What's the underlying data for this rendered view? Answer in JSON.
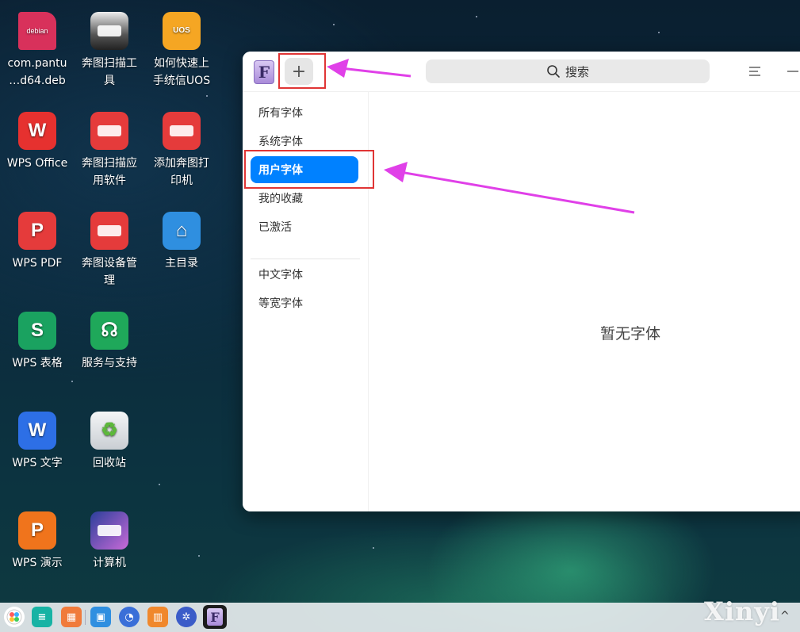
{
  "desktop": {
    "icons": [
      {
        "label": "com.pantu\n…d64.deb",
        "icon": "debian-package-icon",
        "glyph": "debian",
        "color": "#d8315b"
      },
      {
        "label": "奔图扫描工\n具",
        "icon": "scanner-icon",
        "glyph": "",
        "color": "#5a6470"
      },
      {
        "label": "如何快速上\n手统信UOS",
        "icon": "lightbulb-icon",
        "glyph": "UOS",
        "color": "#f5a623"
      },
      {
        "label": "WPS Office",
        "icon": "wps-office-icon",
        "glyph": "W",
        "color": "#e6312f"
      },
      {
        "label": "奔图扫描应\n用软件",
        "icon": "scanner-app-icon",
        "glyph": "",
        "color": "#e53b3b"
      },
      {
        "label": "添加奔图打\n印机",
        "icon": "printer-add-icon",
        "glyph": "",
        "color": "#e53b3b"
      },
      {
        "label": "WPS PDF",
        "icon": "wps-pdf-icon",
        "glyph": "P",
        "color": "#e53b3b"
      },
      {
        "label": "奔图设备管\n理",
        "icon": "device-manager-icon",
        "glyph": "",
        "color": "#e53b3b"
      },
      {
        "label": "主目录",
        "icon": "home-folder-icon",
        "glyph": "⌂",
        "color": "#2f8fe0"
      },
      {
        "label": "WPS 表格",
        "icon": "wps-spreadsheet-icon",
        "glyph": "S",
        "color": "#1aa260"
      },
      {
        "label": "服务与支持",
        "icon": "support-headset-icon",
        "glyph": "☊",
        "color": "#1fa85a"
      },
      {
        "label": "WPS 文字",
        "icon": "wps-writer-icon",
        "glyph": "W",
        "color": "#2d6fe6"
      },
      {
        "label": "回收站",
        "icon": "trash-icon",
        "glyph": "♻",
        "color": "#d8dce0"
      },
      {
        "label": "WPS 演示",
        "icon": "wps-presentation-icon",
        "glyph": "P",
        "color": "#f0741c"
      },
      {
        "label": "计算机",
        "icon": "computer-icon",
        "glyph": "",
        "color": "#6a7fd8"
      }
    ]
  },
  "window": {
    "app_icon_glyph": "F",
    "add_glyph": "+",
    "search_placeholder": "搜索",
    "sidebar": {
      "items": [
        "所有字体",
        "系统字体",
        "用户字体",
        "我的收藏",
        "已激活"
      ],
      "items2": [
        "中文字体",
        "等宽字体"
      ],
      "active": "用户字体"
    },
    "empty_text": "暂无字体"
  },
  "annotations": {
    "box_color": "#e03535",
    "arrow_color": "#e040e8"
  },
  "dock": {
    "items": [
      "launcher-icon",
      "multitask-icon",
      "app-store-icon",
      "file-manager-icon",
      "browser-icon",
      "app-market-icon",
      "settings-icon",
      "font-manager-icon"
    ]
  },
  "watermark": "Xinyi",
  "tray_caret": "^"
}
